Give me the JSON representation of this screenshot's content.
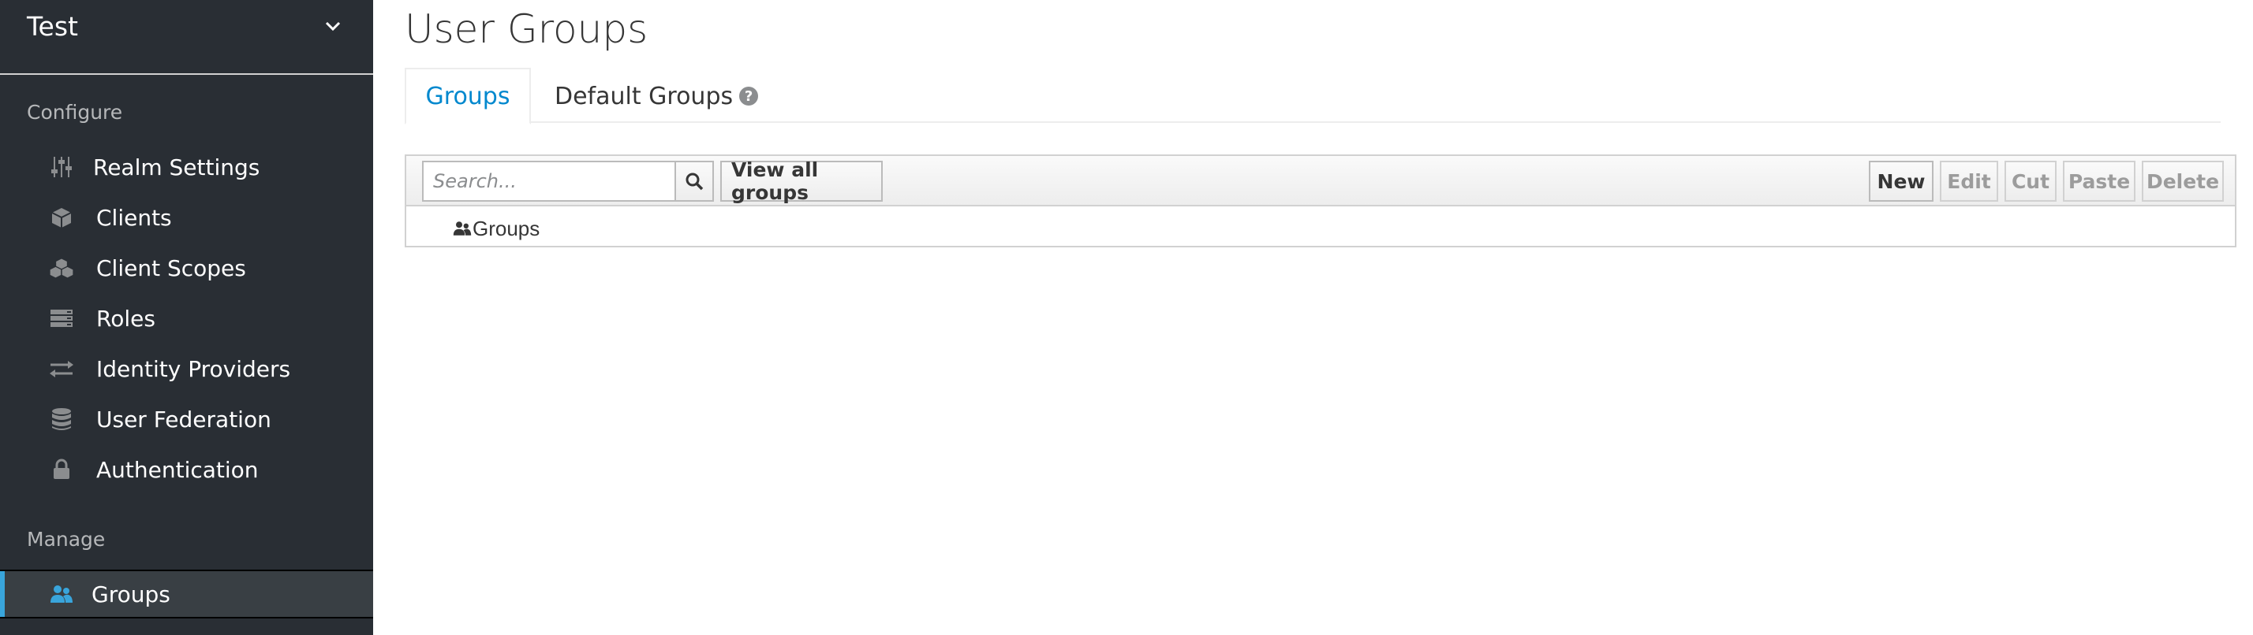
{
  "realm": {
    "name": "Test"
  },
  "sidebar": {
    "configure_label": "Configure",
    "configure_items": [
      {
        "label": "Realm Settings",
        "icon": "sliders-icon"
      },
      {
        "label": "Clients",
        "icon": "cube-icon"
      },
      {
        "label": "Client Scopes",
        "icon": "cubes-icon"
      },
      {
        "label": "Roles",
        "icon": "list-icon"
      },
      {
        "label": "Identity Providers",
        "icon": "exchange-icon"
      },
      {
        "label": "User Federation",
        "icon": "database-icon"
      },
      {
        "label": "Authentication",
        "icon": "lock-icon"
      }
    ],
    "manage_label": "Manage",
    "manage_items": [
      {
        "label": "Groups",
        "icon": "users-icon",
        "active": true
      }
    ]
  },
  "page": {
    "title": "User Groups"
  },
  "tabs": [
    {
      "label": "Groups",
      "active": true
    },
    {
      "label": "Default Groups",
      "active": false
    }
  ],
  "toolbar": {
    "search_placeholder": "Search...",
    "view_all_label": "View all groups",
    "new_label": "New",
    "edit_label": "Edit",
    "cut_label": "Cut",
    "paste_label": "Paste",
    "delete_label": "Delete"
  },
  "tree": {
    "root_label": "Groups"
  },
  "colors": {
    "sidebar_bg": "#292e34",
    "accent": "#39a5dc",
    "link": "#0088ce"
  }
}
